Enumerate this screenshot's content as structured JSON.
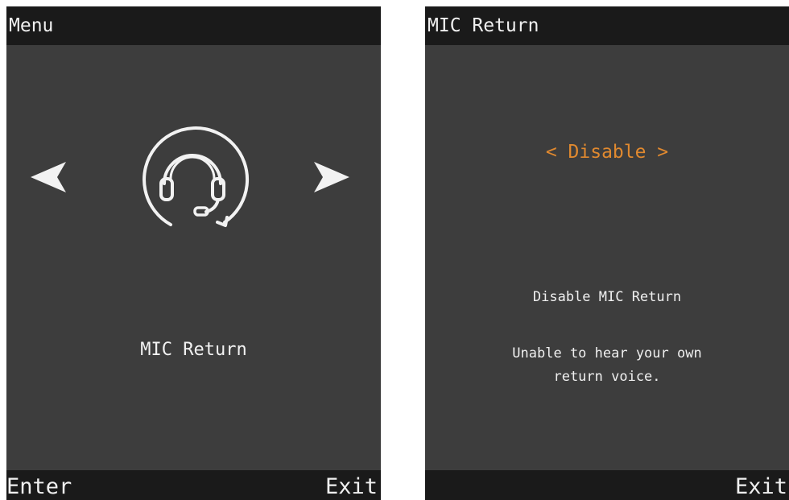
{
  "colors": {
    "screen_bg": "#3d3d3d",
    "bar_bg": "#1a1a1a",
    "text": "#f0f0f0",
    "accent": "#e0892f"
  },
  "left_screen": {
    "title": "Menu",
    "icon": "headset-return-icon",
    "item_label": "MIC Return",
    "softkey_left": "Enter",
    "softkey_right": "Exit"
  },
  "right_screen": {
    "title": "MIC Return",
    "option_value": "< Disable >",
    "description_heading": "Disable MIC Return",
    "description_line1": "Unable to hear your own",
    "description_line2": "return voice.",
    "softkey_right": "Exit"
  }
}
